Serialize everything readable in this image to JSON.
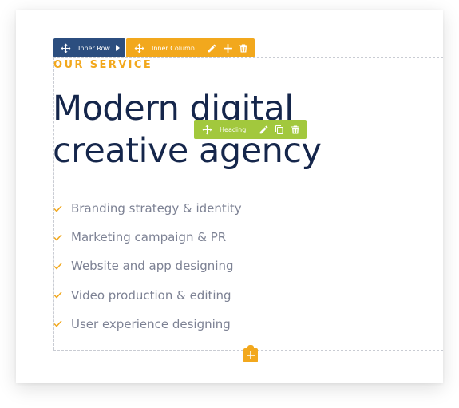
{
  "toolbars": {
    "inner_row": {
      "label": "Inner Row",
      "color": "#2c4e7f"
    },
    "inner_column": {
      "label": "Inner Column",
      "color": "#f2a81d"
    },
    "heading": {
      "label": "Heading",
      "color": "#a2c83d"
    }
  },
  "content": {
    "eyebrow": "OUR SERVICE",
    "heading_line1": "Modern digital",
    "heading_line2": "creative agency",
    "services": [
      "Branding strategy & identity",
      "Marketing campaign & PR",
      "Website and app designing",
      "Video production & editing",
      "User experience designing"
    ]
  },
  "icons": {
    "move": "move-icon",
    "arrow": "caret-right-icon",
    "edit": "pencil-icon",
    "add": "plus-icon",
    "duplicate": "copy-icon",
    "delete": "trash-icon",
    "check": "check-icon"
  },
  "colors": {
    "accent": "#f2a81d",
    "heading_text": "#15264b",
    "list_text": "#7d8294"
  }
}
